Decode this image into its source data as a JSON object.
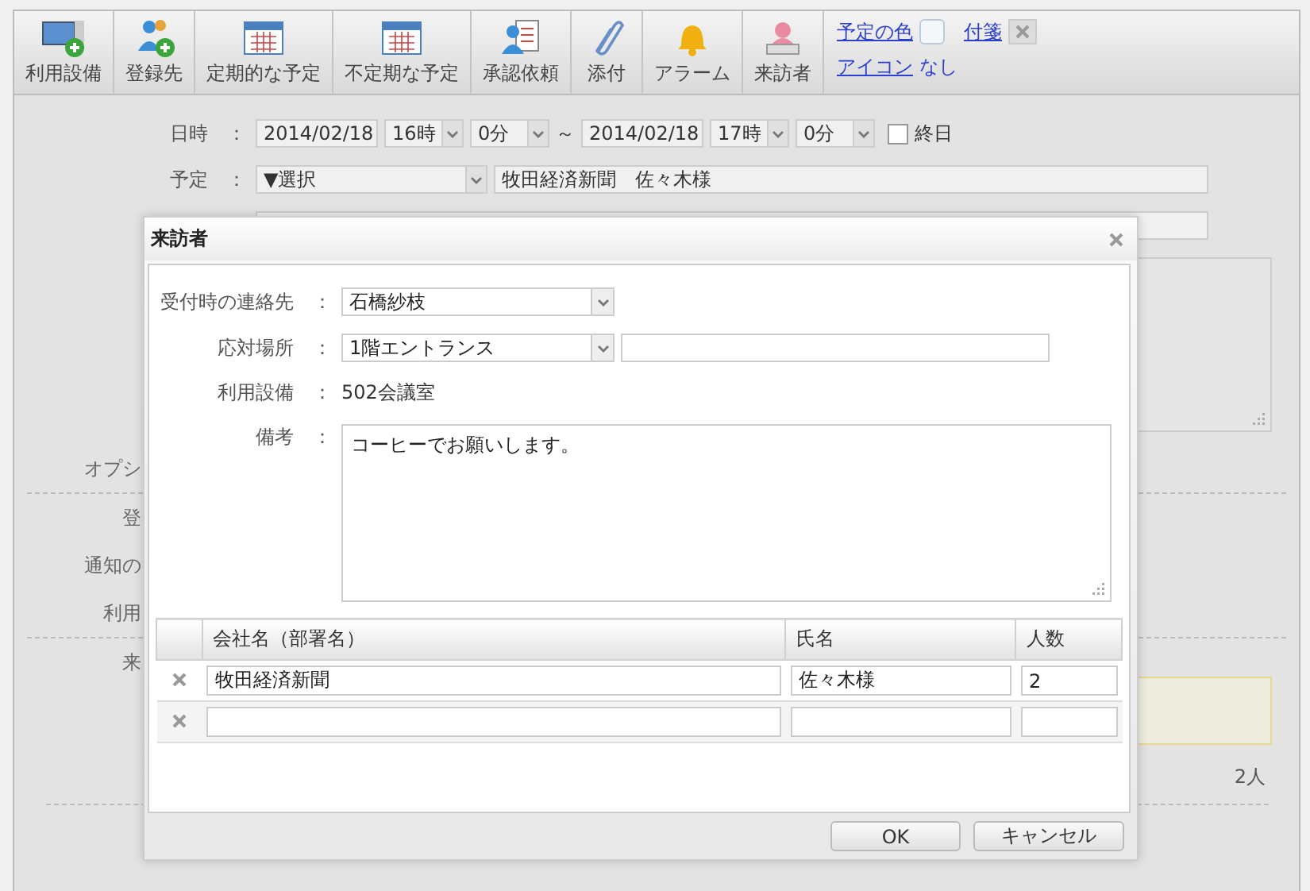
{
  "toolbar": {
    "buttons": [
      {
        "label": "利用設備"
      },
      {
        "label": "登録先"
      },
      {
        "label": "定期的な予定"
      },
      {
        "label": "不定期な予定"
      },
      {
        "label": "承認依頼"
      },
      {
        "label": "添付"
      },
      {
        "label": "アラーム"
      },
      {
        "label": "来訪者"
      }
    ],
    "color_link": "予定の色",
    "sticky_link": "付箋",
    "icon_link": "アイコン",
    "icon_value": "なし"
  },
  "form": {
    "datetime": {
      "label": "日時",
      "colon": "：",
      "start_date": "2014/02/18",
      "start_hour": "16時",
      "start_minute": "0分",
      "separator": "～",
      "end_date": "2014/02/18",
      "end_hour": "17時",
      "end_minute": "0分",
      "all_day": {
        "label": "終日",
        "checked": false
      }
    },
    "schedule": {
      "label": "予定",
      "colon": "：",
      "select": "▼選択",
      "title": "牧田経済新聞　佐々木様"
    },
    "section_labels": [
      "オプシ",
      "登",
      "通知の",
      "利用",
      "来"
    ],
    "visitor_count": "2人"
  },
  "dialog": {
    "title": "来訪者",
    "fields": [
      {
        "kind": "select",
        "label": "受付時の連絡先",
        "colon": "：",
        "value": "石橋紗枝"
      },
      {
        "kind": "select_text",
        "label": "応対場所",
        "colon": "：",
        "value": "1階エントランス"
      },
      {
        "kind": "text",
        "label": "利用設備",
        "colon": "：",
        "value": "502会議室"
      },
      {
        "kind": "textarea",
        "label": "備考",
        "colon": "：",
        "value": "コーヒーでお願いします。"
      }
    ],
    "table": {
      "columns": [
        "会社名（部署名）",
        "氏名",
        "人数"
      ],
      "rows": [
        {
          "company": "牧田経済新聞",
          "name": "佐々木様",
          "count": "2"
        },
        {}
      ]
    },
    "buttons": [
      "OK",
      "キャンセル"
    ]
  }
}
